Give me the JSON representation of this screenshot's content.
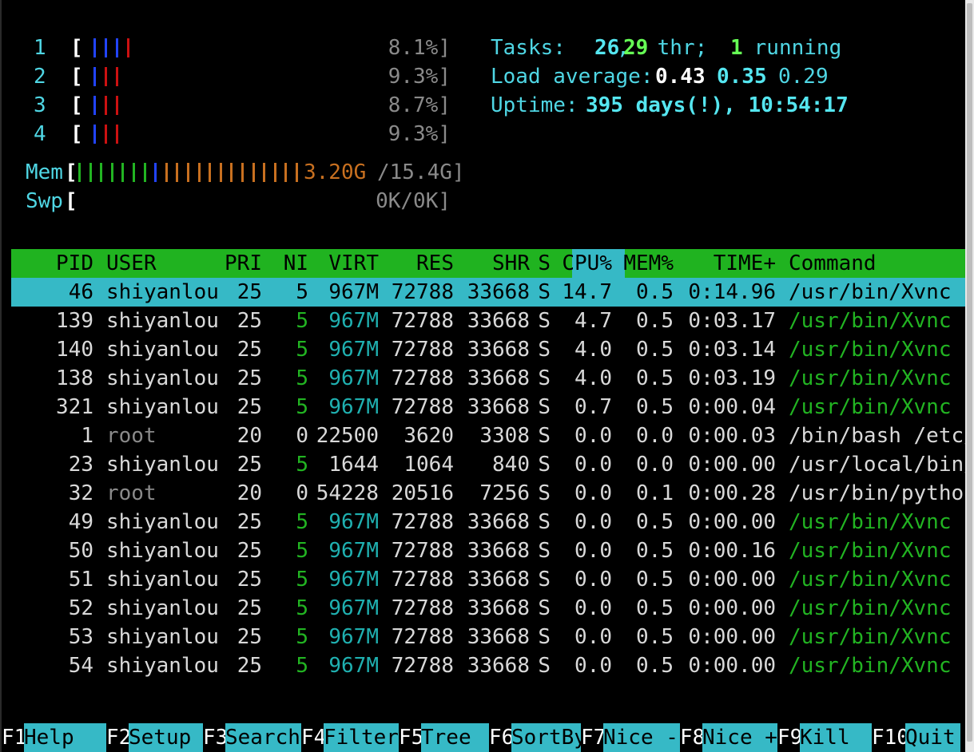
{
  "meters": {
    "cpus": [
      {
        "label": "1",
        "value": "8.1%]"
      },
      {
        "label": "2",
        "value": "9.3%]"
      },
      {
        "label": "3",
        "value": "8.7%]"
      },
      {
        "label": "4",
        "value": "9.3%]"
      }
    ],
    "mem": {
      "label": "Mem",
      "value_used": "3.20G",
      "value_total": "/15.4G]"
    },
    "swp": {
      "label": "Swp",
      "value": "0K/0K]"
    },
    "bracket_open": "["
  },
  "summary": {
    "tasks_label": "Tasks: ",
    "tasks_count": "26",
    "sep1": ", ",
    "threads": "29",
    "thr_label": " thr; ",
    "running": "1",
    "running_label": " running",
    "load_label": "Load average: ",
    "load1": "0.43",
    "load5": "0.35",
    "load15": "0.29",
    "uptime_label": "Uptime: ",
    "uptime_value": "395 days(!), 10:54:17"
  },
  "table": {
    "headers": {
      "pid": "PID",
      "user": "USER",
      "pri": "PRI",
      "ni": "NI",
      "virt": "VIRT",
      "res": "RES",
      "shr": "SHR",
      "s": "S",
      "cpu": "CPU%",
      "mem": "MEM%",
      "time": "TIME+",
      "command": "Command"
    },
    "rows": [
      {
        "pid": "46",
        "user": "shiyanlou",
        "pri": "25",
        "ni": "5",
        "virt": "967M",
        "res": "72788",
        "shr": "33668",
        "s": "S",
        "cpu": "14.7",
        "mem": "0.5",
        "time": "0:14.96",
        "command": "/usr/bin/Xvnc :",
        "selected": true
      },
      {
        "pid": "139",
        "user": "shiyanlou",
        "pri": "25",
        "ni": "5",
        "virt": "967M",
        "res": "72788",
        "shr": "33668",
        "s": "S",
        "cpu": "4.7",
        "mem": "0.5",
        "time": "0:03.17",
        "command": "/usr/bin/Xvnc :"
      },
      {
        "pid": "140",
        "user": "shiyanlou",
        "pri": "25",
        "ni": "5",
        "virt": "967M",
        "res": "72788",
        "shr": "33668",
        "s": "S",
        "cpu": "4.0",
        "mem": "0.5",
        "time": "0:03.14",
        "command": "/usr/bin/Xvnc :"
      },
      {
        "pid": "138",
        "user": "shiyanlou",
        "pri": "25",
        "ni": "5",
        "virt": "967M",
        "res": "72788",
        "shr": "33668",
        "s": "S",
        "cpu": "4.0",
        "mem": "0.5",
        "time": "0:03.19",
        "command": "/usr/bin/Xvnc :"
      },
      {
        "pid": "321",
        "user": "shiyanlou",
        "pri": "25",
        "ni": "5",
        "virt": "967M",
        "res": "72788",
        "shr": "33668",
        "s": "S",
        "cpu": "0.7",
        "mem": "0.5",
        "time": "0:00.04",
        "command": "/usr/bin/Xvnc :"
      },
      {
        "pid": "1",
        "user": "root",
        "pri": "20",
        "ni": "0",
        "virt": "22500",
        "res": "3620",
        "shr": "3308",
        "s": "S",
        "cpu": "0.0",
        "mem": "0.0",
        "time": "0:00.03",
        "command": "/bin/bash /etc/"
      },
      {
        "pid": "23",
        "user": "shiyanlou",
        "pri": "25",
        "ni": "5",
        "virt": "1644",
        "res": "1064",
        "shr": "840",
        "s": "S",
        "cpu": "0.0",
        "mem": "0.0",
        "time": "0:00.00",
        "command": "/usr/local/bin/"
      },
      {
        "pid": "32",
        "user": "root",
        "pri": "20",
        "ni": "0",
        "virt": "54228",
        "res": "20516",
        "shr": "7256",
        "s": "S",
        "cpu": "0.0",
        "mem": "0.1",
        "time": "0:00.28",
        "command": "/usr/bin/python"
      },
      {
        "pid": "49",
        "user": "shiyanlou",
        "pri": "25",
        "ni": "5",
        "virt": "967M",
        "res": "72788",
        "shr": "33668",
        "s": "S",
        "cpu": "0.0",
        "mem": "0.5",
        "time": "0:00.00",
        "command": "/usr/bin/Xvnc :"
      },
      {
        "pid": "50",
        "user": "shiyanlou",
        "pri": "25",
        "ni": "5",
        "virt": "967M",
        "res": "72788",
        "shr": "33668",
        "s": "S",
        "cpu": "0.0",
        "mem": "0.5",
        "time": "0:00.16",
        "command": "/usr/bin/Xvnc :"
      },
      {
        "pid": "51",
        "user": "shiyanlou",
        "pri": "25",
        "ni": "5",
        "virt": "967M",
        "res": "72788",
        "shr": "33668",
        "s": "S",
        "cpu": "0.0",
        "mem": "0.5",
        "time": "0:00.00",
        "command": "/usr/bin/Xvnc :"
      },
      {
        "pid": "52",
        "user": "shiyanlou",
        "pri": "25",
        "ni": "5",
        "virt": "967M",
        "res": "72788",
        "shr": "33668",
        "s": "S",
        "cpu": "0.0",
        "mem": "0.5",
        "time": "0:00.00",
        "command": "/usr/bin/Xvnc :"
      },
      {
        "pid": "53",
        "user": "shiyanlou",
        "pri": "25",
        "ni": "5",
        "virt": "967M",
        "res": "72788",
        "shr": "33668",
        "s": "S",
        "cpu": "0.0",
        "mem": "0.5",
        "time": "0:00.00",
        "command": "/usr/bin/Xvnc :"
      },
      {
        "pid": "54",
        "user": "shiyanlou",
        "pri": "25",
        "ni": "5",
        "virt": "967M",
        "res": "72788",
        "shr": "33668",
        "s": "S",
        "cpu": "0.0",
        "mem": "0.5",
        "time": "0:00.00",
        "command": "/usr/bin/Xvnc :"
      }
    ]
  },
  "function_bar": [
    {
      "key": "F1",
      "label": "Help  "
    },
    {
      "key": "F2",
      "label": "Setup "
    },
    {
      "key": "F3",
      "label": "Search"
    },
    {
      "key": "F4",
      "label": "Filter"
    },
    {
      "key": "F5",
      "label": "Tree  "
    },
    {
      "key": "F6",
      "label": "SortBy"
    },
    {
      "key": "F7",
      "label": "Nice -"
    },
    {
      "key": "F8",
      "label": "Nice +"
    },
    {
      "key": "F9",
      "label": "Kill  "
    },
    {
      "key": "F10",
      "label": "Quit "
    }
  ],
  "colors": {
    "background": "#000000",
    "header_green": "#20b320",
    "selection_cyan": "#36b9c6",
    "meter_label_cyan": "#4fd6e4",
    "mem_orange": "#c87020",
    "command_green": "#22b422"
  }
}
